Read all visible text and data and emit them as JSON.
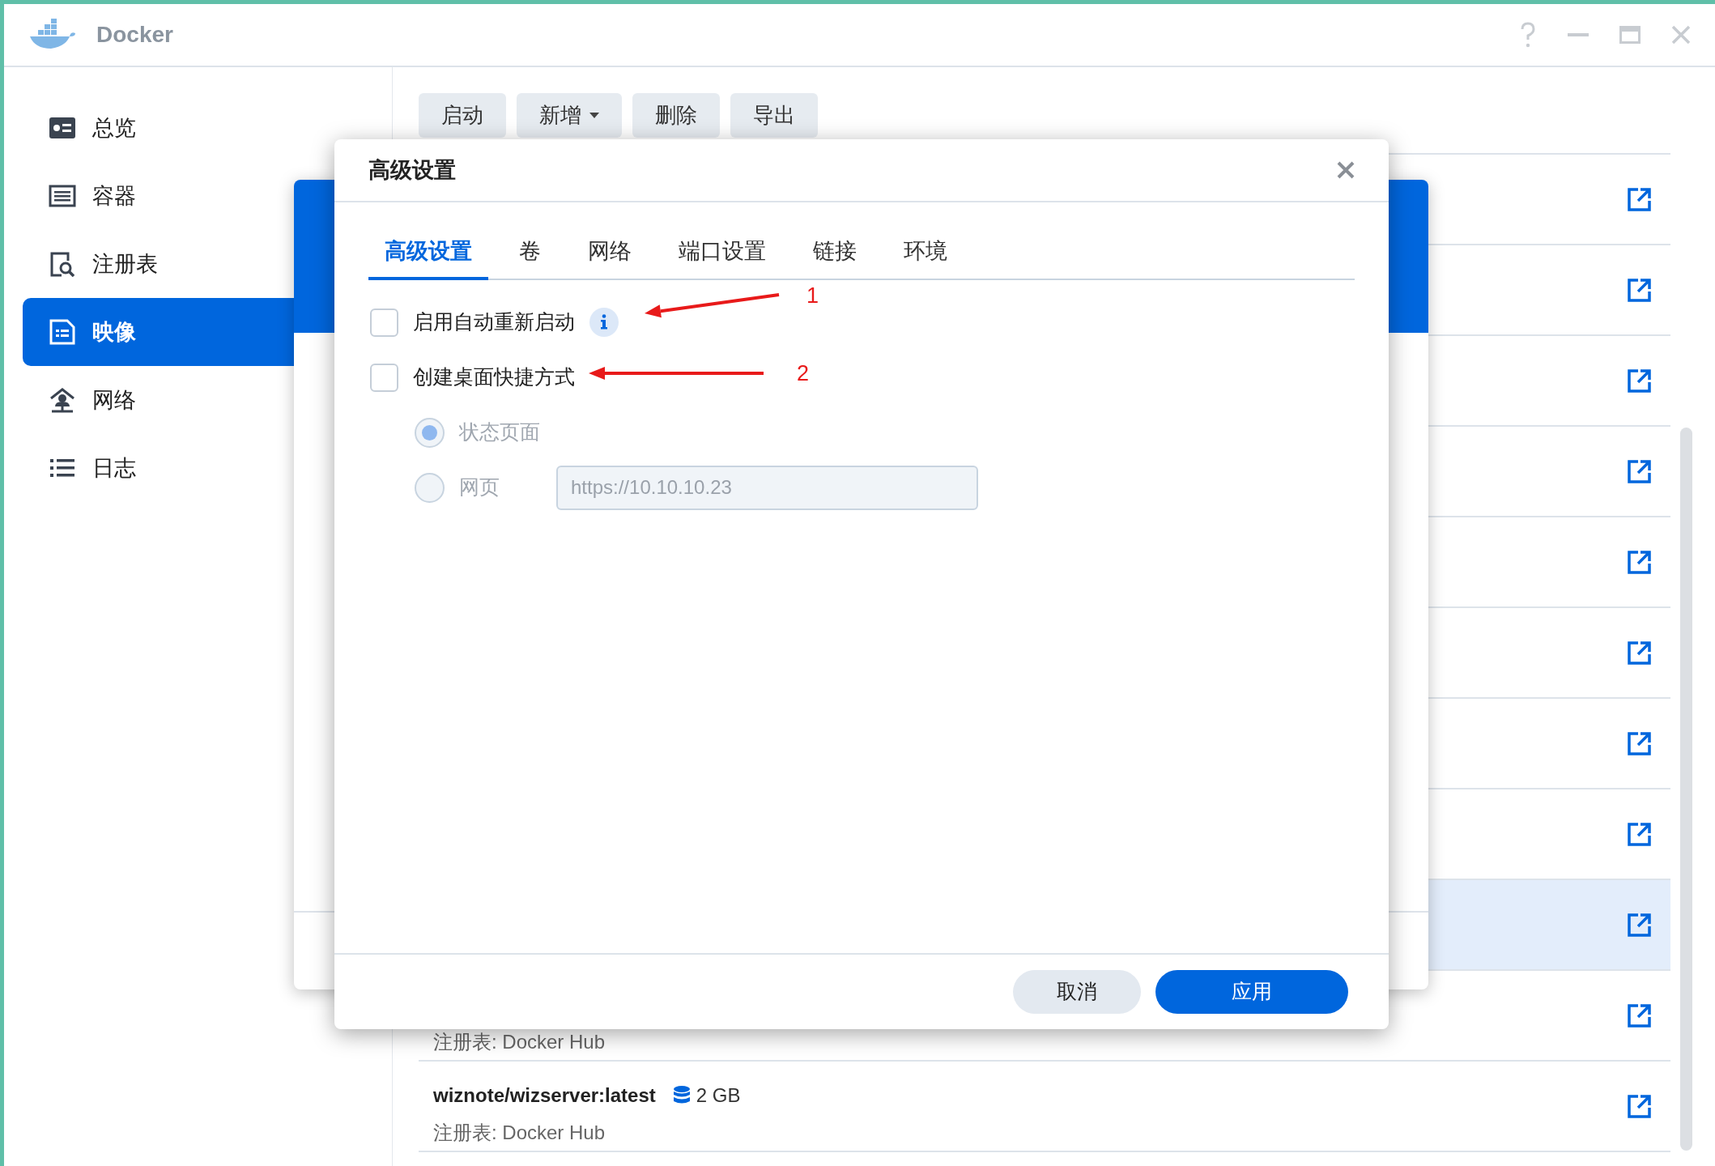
{
  "window": {
    "title": "Docker"
  },
  "sidebar": {
    "items": [
      {
        "label": "总览",
        "kind": "overview",
        "selected": false
      },
      {
        "label": "容器",
        "kind": "container",
        "selected": false
      },
      {
        "label": "注册表",
        "kind": "registry",
        "selected": false
      },
      {
        "label": "映像",
        "kind": "image",
        "selected": true
      },
      {
        "label": "网络",
        "kind": "network",
        "selected": false
      },
      {
        "label": "日志",
        "kind": "log",
        "selected": false
      }
    ]
  },
  "toolbar": {
    "buttons": [
      {
        "label": "启动",
        "dropdown": false
      },
      {
        "label": "新增",
        "dropdown": true
      },
      {
        "label": "删除",
        "dropdown": false
      },
      {
        "label": "导出",
        "dropdown": false
      }
    ]
  },
  "image_list": {
    "rows": [
      {
        "selected": false
      },
      {
        "selected": false
      },
      {
        "selected": false
      },
      {
        "selected": false
      },
      {
        "selected": false
      },
      {
        "selected": false
      },
      {
        "selected": false
      },
      {
        "selected": false
      },
      {
        "selected": true
      },
      {
        "registry": "注册表: Docker Hub",
        "selected": false
      },
      {
        "name": "wiznote/wizserver:latest",
        "size": "2 GB",
        "registry": "注册表: Docker Hub",
        "selected": false
      }
    ]
  },
  "dialog": {
    "title": "高级设置",
    "tabs": [
      {
        "label": "高级设置",
        "selected": true
      },
      {
        "label": "卷",
        "selected": false
      },
      {
        "label": "网络",
        "selected": false
      },
      {
        "label": "端口设置",
        "selected": false
      },
      {
        "label": "链接",
        "selected": false
      },
      {
        "label": "环境",
        "selected": false
      }
    ],
    "options": [
      {
        "kind": "checkbox",
        "label": "启用自动重新启动",
        "checked": false,
        "info": true
      },
      {
        "kind": "checkbox",
        "label": "创建桌面快捷方式",
        "checked": false
      },
      {
        "kind": "radio",
        "label": "状态页面",
        "selected": true,
        "disabled": true
      },
      {
        "kind": "radio",
        "label": "网页",
        "selected": false,
        "disabled": true,
        "field": {
          "value": "https://10.10.10.23"
        }
      }
    ],
    "buttons": [
      {
        "label": "取消",
        "primary": false
      },
      {
        "label": "应用",
        "primary": true
      }
    ]
  },
  "annotations": [
    {
      "label": "1"
    },
    {
      "label": "2"
    }
  ]
}
